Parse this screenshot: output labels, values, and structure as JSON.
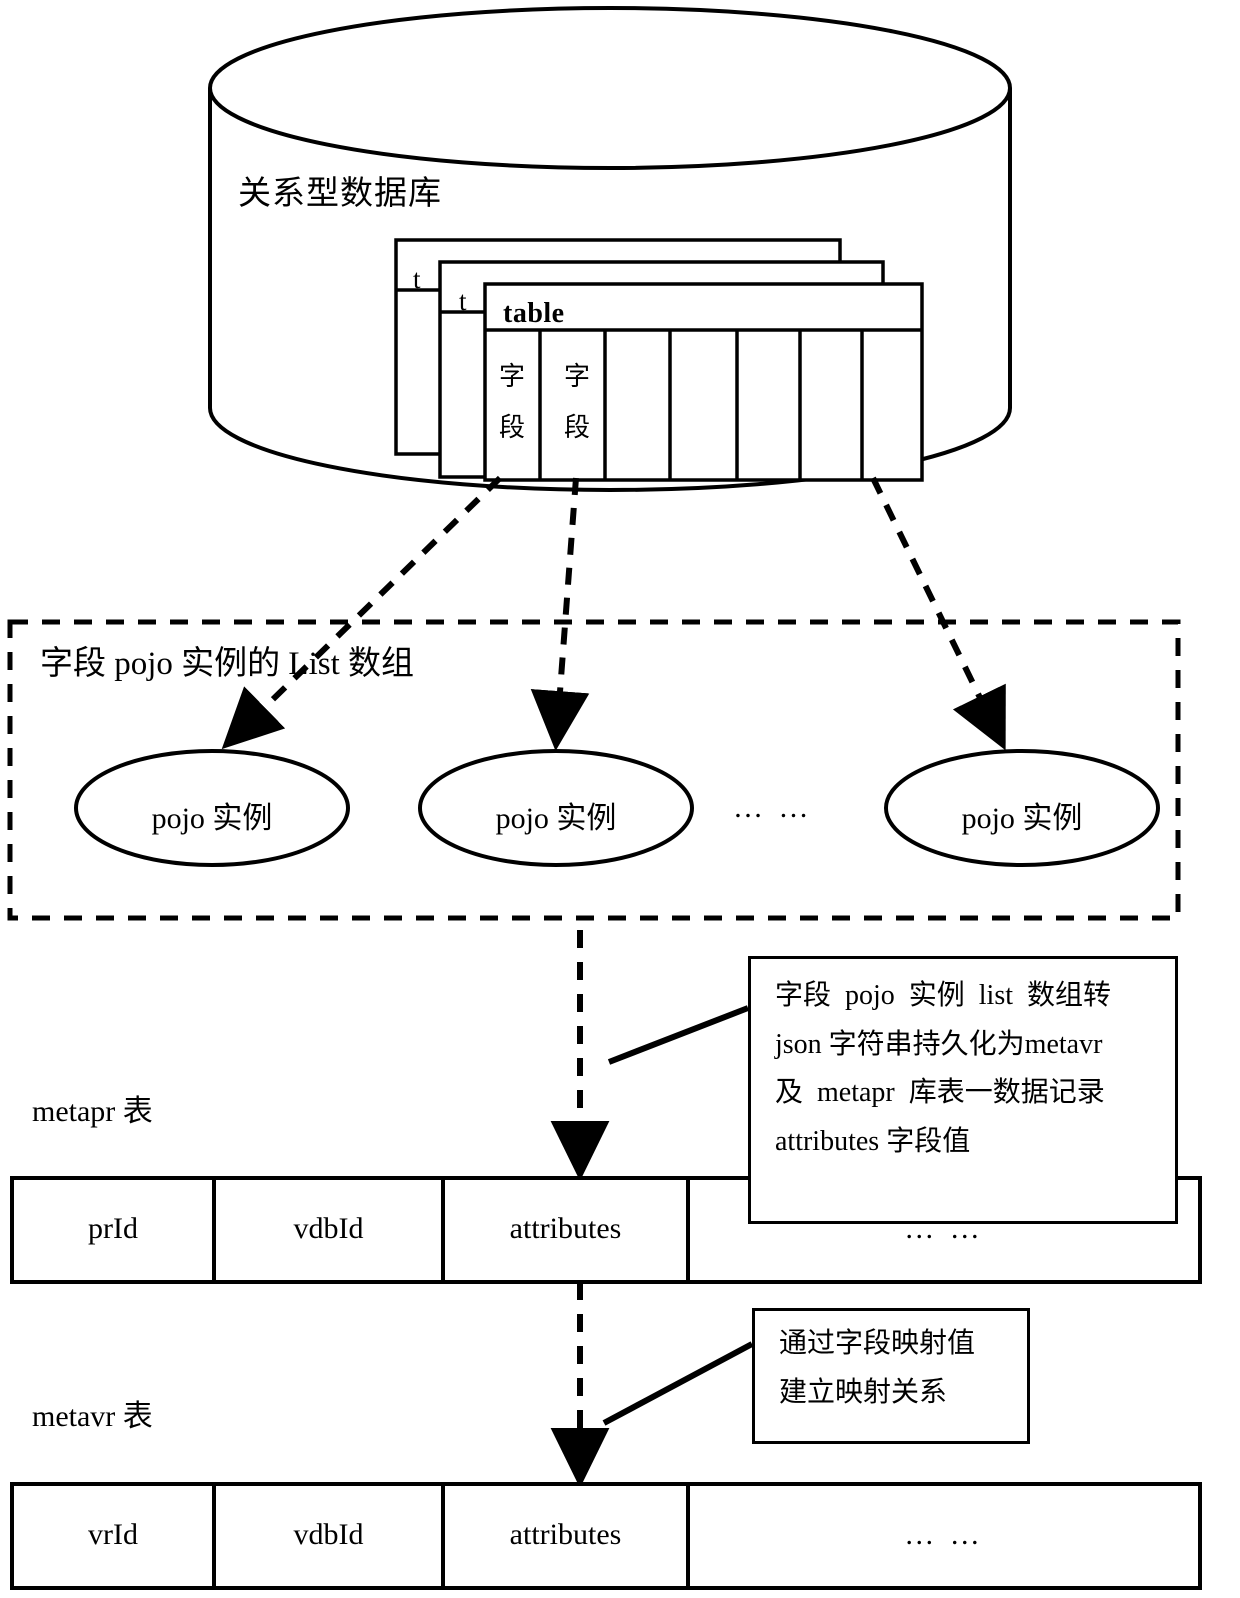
{
  "database": {
    "label": "关系型数据库",
    "tables": {
      "back_tab": "t",
      "middle_tab": "t",
      "front_title": "table",
      "field_cells": [
        "字 段",
        "字 段"
      ],
      "empty_columns": 5
    }
  },
  "pojo_list": {
    "title": "字段 pojo 实例的 List 数组",
    "nodes": [
      {
        "label": "pojo 实例"
      },
      {
        "label": "pojo 实例"
      },
      {
        "label": "pojo 实例"
      }
    ],
    "ellipsis": "… …"
  },
  "annotations": [
    {
      "id": "persist-note",
      "lines": [
        "字段  pojo  实例  list  数组转",
        "json 字符串持久化为metavr",
        "及  metapr  库表一数据记录",
        "attributes 字段值"
      ]
    },
    {
      "id": "mapping-note",
      "lines": [
        "通过字段映射值",
        "建立映射关系"
      ]
    }
  ],
  "tables": [
    {
      "id": "metapr",
      "caption": "metapr 表",
      "columns": [
        "prId",
        "vdbId",
        "attributes",
        "… …"
      ]
    },
    {
      "id": "metavr",
      "caption": "metavr 表",
      "columns": [
        "vrId",
        "vdbId",
        "attributes",
        "… …"
      ]
    }
  ],
  "colors": {
    "stroke": "#000000",
    "background": "#ffffff"
  }
}
